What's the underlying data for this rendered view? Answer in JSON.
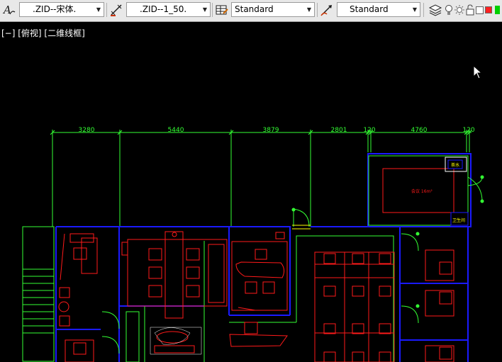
{
  "toolbar": {
    "text_style": ".ZID--宋体.",
    "dim_style": ".ZID--1_50.",
    "table_style": "Standard",
    "multileader_style": "Standard"
  },
  "viewport": {
    "label": "[−] [俯视] [二维线框]"
  },
  "drawing": {
    "dimensions": [
      "3280",
      "5440",
      "3879",
      "2801",
      "120",
      "4760",
      "120"
    ],
    "room_labels": [
      "茶水",
      "会议 16m²",
      "卫生间"
    ]
  },
  "colors": {
    "wall": "#0000cc",
    "furniture": "#ff1a1a",
    "dimension": "#33ff33",
    "text": "#ffffff"
  }
}
